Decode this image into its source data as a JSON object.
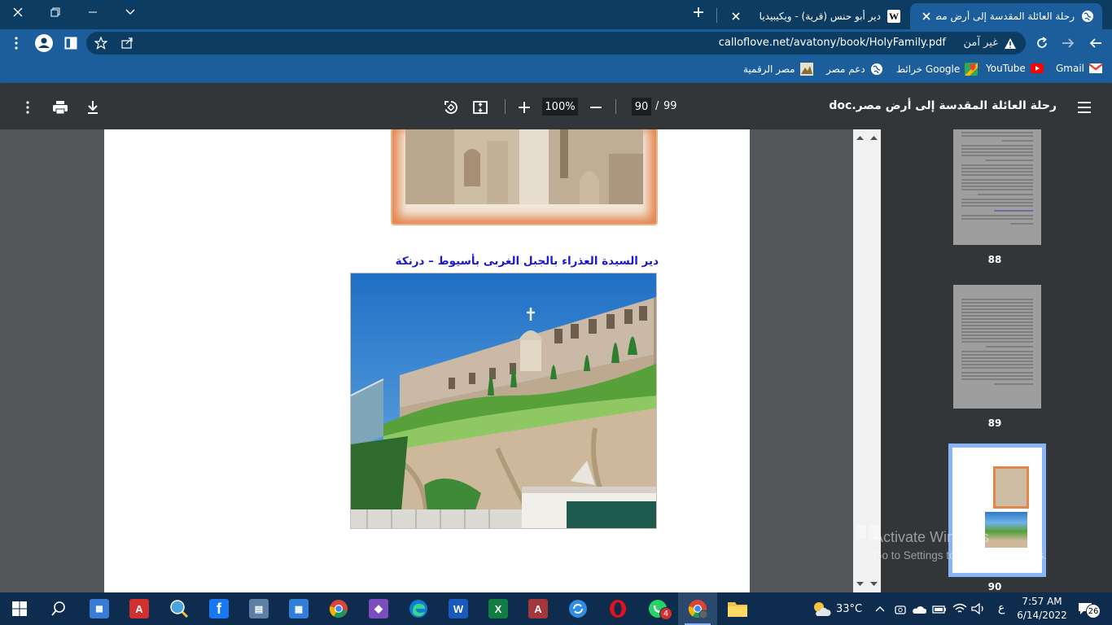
{
  "browser": {
    "tabs": [
      {
        "title": "رحلة العائلة المقدسة إلى أرض مصر",
        "active": true
      },
      {
        "title": "دير أبو حنس (قرية) - ويكيبيديا",
        "active": false
      }
    ],
    "url": "calloflove.net/avatony/book/HolyFamily.pdf",
    "security_text": "غير آمن",
    "bookmarks": [
      {
        "label": "Gmail",
        "icon": "gmail-icon"
      },
      {
        "label": "YouTube",
        "icon": "youtube-icon"
      },
      {
        "label": "خرائط Google",
        "icon": "maps-icon"
      },
      {
        "label": "دعم مصر",
        "icon": "globe-icon"
      },
      {
        "label": "مصر الرقمية",
        "icon": "digital-egypt-icon"
      }
    ]
  },
  "pdf": {
    "title": "رحلة العائلة المقدسة إلى أرض مصر.doc",
    "current_page": "90",
    "page_sep": "/",
    "total_pages": "99",
    "zoom": "100%",
    "caption": "دير السيدة العذراء بالجبل الغربى بأسيوط – درنكة",
    "thumbnails": [
      {
        "page": "88"
      },
      {
        "page": "89"
      },
      {
        "page": "90",
        "selected": true
      }
    ]
  },
  "watermark": {
    "title": "Activate Windows",
    "subtitle": "Go to Settings to activate Windows."
  },
  "taskbar": {
    "temperature": "33°C",
    "time": "7:57 AM",
    "date": "6/14/2022",
    "lang": "ع",
    "notifications": "26",
    "whatsapp_badge": "4",
    "apps": [
      "start",
      "search",
      "explorer-app",
      "acrobat",
      "magnifier",
      "facebook",
      "calculator",
      "calendar",
      "chrome",
      "visual-studio",
      "edge",
      "word",
      "excel",
      "access",
      "sync",
      "opera",
      "whatsapp",
      "chrome-active",
      "file-explorer"
    ]
  },
  "colors": {
    "tab_bar": "#0d3c63",
    "address_bar": "#1c5e9c",
    "pdf_toolbar": "#323639",
    "caption": "#1a1ad6",
    "taskbar": "#0d2c4e"
  }
}
